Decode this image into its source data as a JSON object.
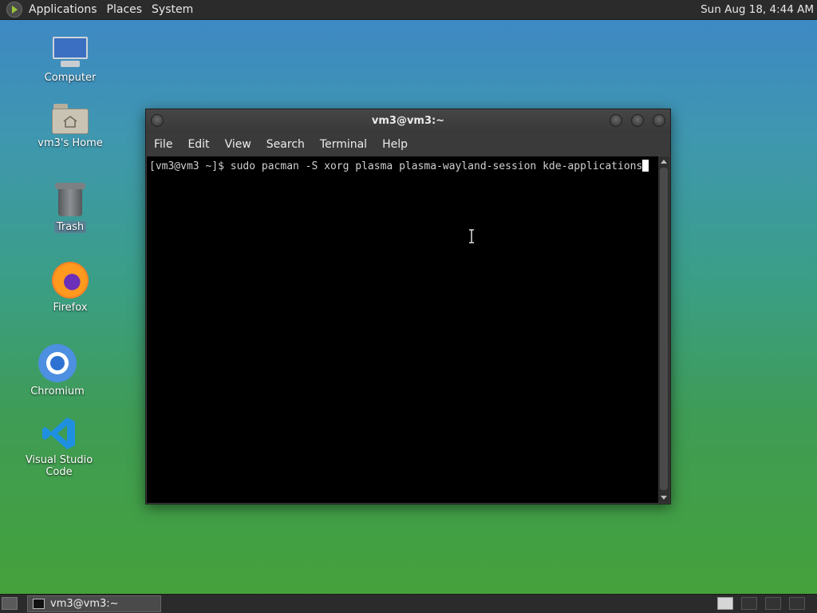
{
  "top_panel": {
    "menus": [
      "Applications",
      "Places",
      "System"
    ],
    "clock": "Sun Aug 18,  4:44 AM"
  },
  "desktop_icons": [
    {
      "label": "Computer",
      "icon": "computer-icon"
    },
    {
      "label": "vm3's Home",
      "icon": "home-folder-icon"
    },
    {
      "label": "Trash",
      "icon": "trash-icon"
    },
    {
      "label": "Firefox",
      "icon": "firefox-icon"
    },
    {
      "label": "Chromium",
      "icon": "chromium-icon"
    },
    {
      "label": "Visual Studio Code",
      "icon": "vscode-icon"
    }
  ],
  "terminal": {
    "title": "vm3@vm3:~",
    "menu": [
      "File",
      "Edit",
      "View",
      "Search",
      "Terminal",
      "Help"
    ],
    "prompt": "[vm3@vm3 ~]$ ",
    "command": "sudo pacman -S xorg plasma plasma-wayland-session kde-applications"
  },
  "taskbar": {
    "tasks": [
      {
        "label": "vm3@vm3:~",
        "icon": "terminal-icon"
      }
    ]
  }
}
